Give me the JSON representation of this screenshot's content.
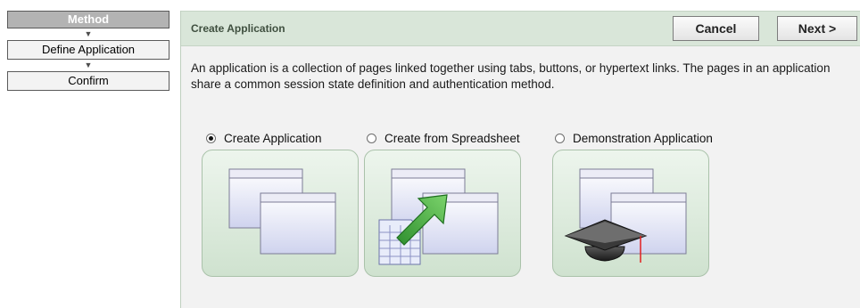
{
  "wizard": {
    "steps": [
      {
        "label": "Method",
        "current": true
      },
      {
        "label": "Define Application",
        "current": false
      },
      {
        "label": "Confirm",
        "current": false
      }
    ]
  },
  "main": {
    "title": "Create Application",
    "buttons": {
      "cancel": "Cancel",
      "next": "Next >"
    },
    "description": "An application is a collection of pages linked together using tabs, buttons, or hypertext links. The pages in an application share a common session state definition and authentication method.",
    "options": [
      {
        "label": "Create Application",
        "selected": true,
        "icon": "application-windows-icon"
      },
      {
        "label": "Create from Spreadsheet",
        "selected": false,
        "icon": "spreadsheet-import-icon"
      },
      {
        "label": "Demonstration Application",
        "selected": false,
        "icon": "graduation-cap-icon"
      }
    ]
  },
  "colors": {
    "header_bg": "#d9e6d9",
    "card_bg": "#cfe2cf",
    "step_current_bg": "#b3b3b3",
    "arrow_green": "#3fae3f"
  }
}
